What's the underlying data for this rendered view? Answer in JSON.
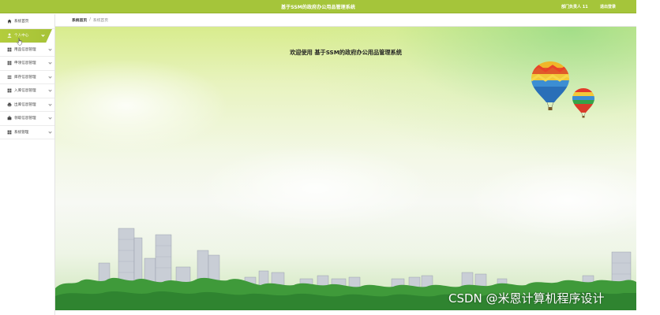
{
  "header": {
    "title": "基于SSM的政府办公用品管理系统",
    "user_label": "部门负责人 11",
    "logout_label": "退出登录",
    "bg_color": "#a5c53a"
  },
  "sidebar": {
    "items": [
      {
        "label": "系统首页",
        "icon": "home-icon"
      },
      {
        "label": "个人中心",
        "icon": "person-icon"
      },
      {
        "label": "用品信息管理",
        "icon": "grid-icon"
      },
      {
        "label": "申领信息管理",
        "icon": "grid-icon"
      },
      {
        "label": "库存信息管理",
        "icon": "list-icon"
      },
      {
        "label": "入库信息管理",
        "icon": "grid-icon"
      },
      {
        "label": "出库信息管理",
        "icon": "printer-icon"
      },
      {
        "label": "领取信息管理",
        "icon": "briefcase-icon"
      },
      {
        "label": "系统管理",
        "icon": "grid-icon"
      }
    ],
    "active_index": 1,
    "active_color": "#b3cd3c"
  },
  "breadcrumb": {
    "home": "系统首页",
    "separator": "/",
    "current": "系统首页"
  },
  "main": {
    "welcome": "欢迎使用 基于SSM的政府办公用品管理系统"
  },
  "watermark": "CSDN @米恩计算机程序设计"
}
